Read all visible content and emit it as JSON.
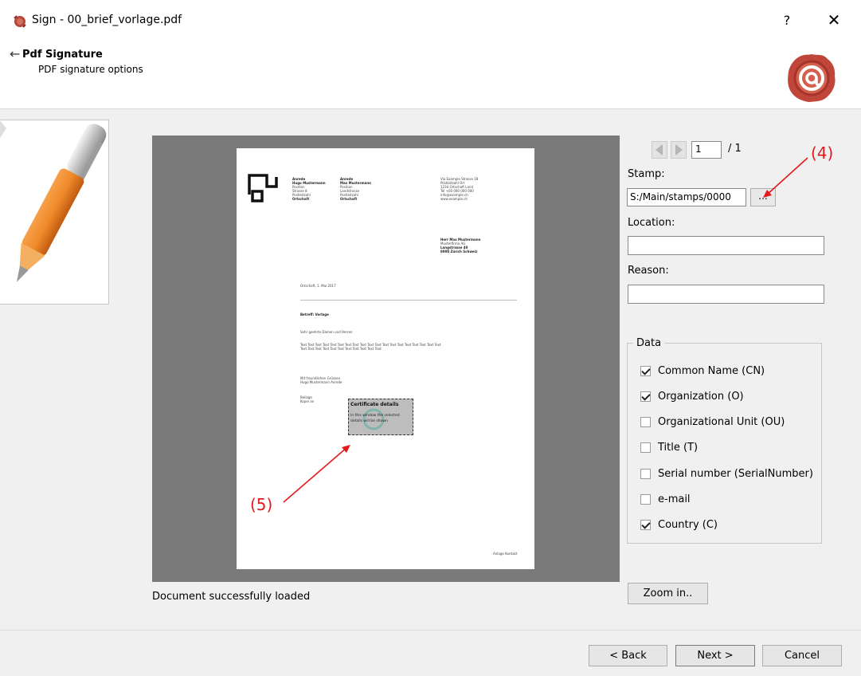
{
  "window": {
    "title": "Sign - 00_brief_vorlage.pdf",
    "help": "?",
    "close": "✕",
    "app_icon": "wax-seal-icon"
  },
  "header": {
    "back_glyph": "←",
    "heading": "Pdf Signature",
    "subtitle": "PDF signature options",
    "logo_icon": "wax-seal-at-icon"
  },
  "preview": {
    "status": "Document successfully loaded",
    "document": {
      "sender_cols": [
        [
          "Anrede",
          "Hugo Mustermann",
          "Position",
          "Strasse 8",
          "Postleitzahl",
          "Ortschaft"
        ],
        [
          "Anrede",
          "Max Mustermann",
          "Position",
          "Landstrasse",
          "Postleitzahl",
          "Ortschaft"
        ],
        [
          "Via Example Strasse 18",
          "Postleitzahl Ort",
          "1234 Ortschaft Land",
          "Tel +00 000 000 000",
          "info@example.ch",
          "www.example.ch"
        ]
      ],
      "recipient": [
        "Herr Max Mustermann",
        "Musterfirma AG",
        "Langstrasse 40",
        "8000 Zürich Schweiz"
      ],
      "date_line": "Ortschaft, 1. Mai 2017",
      "subject": "Betreff: Vorlage",
      "salutation": "Sehr geehrte Damen und Herren",
      "body_lines": [
        "Text Text Text Text Text Text Text Text Text Text Text Text Text Text Text Text Text Text Text",
        "Text Text Text Text Text Text Text Text Text Text Text"
      ],
      "closing_lines": [
        "Mit freundlichen Grüssen",
        "Hugo Mustermann Anrede"
      ],
      "footer_left": [
        "Beilage",
        "Kopie an"
      ],
      "footer_right": "Anlage Kontakt",
      "cert_title": "Certificate details",
      "cert_text": [
        "In this window the selected",
        "details will be shown"
      ]
    }
  },
  "pager": {
    "prev_icon": "arrow-left-icon",
    "next_icon": "arrow-right-icon",
    "current_page": "1",
    "total": "/ 1"
  },
  "form": {
    "stamp_label": "Stamp:",
    "stamp_value": "S:/Main/stamps/0000",
    "browse_label": "...",
    "location_label": "Location:",
    "location_value": "",
    "reason_label": "Reason:",
    "reason_value": ""
  },
  "data_group": {
    "legend": "Data",
    "items": [
      {
        "label": "Common Name (CN)",
        "checked": true
      },
      {
        "label": "Organization (O)",
        "checked": true
      },
      {
        "label": "Organizational Unit (OU)",
        "checked": false
      },
      {
        "label": "Title (T)",
        "checked": false
      },
      {
        "label": "Serial number (SerialNumber)",
        "checked": false
      },
      {
        "label": "e-mail",
        "checked": false
      },
      {
        "label": "Country (C)",
        "checked": true
      }
    ]
  },
  "buttons": {
    "zoom": "Zoom in..",
    "back": "< Back",
    "next": "Next >",
    "cancel": "Cancel"
  },
  "annotations": {
    "label_4": "(4)",
    "label_5": "(5)",
    "color": "#e31a1c"
  }
}
